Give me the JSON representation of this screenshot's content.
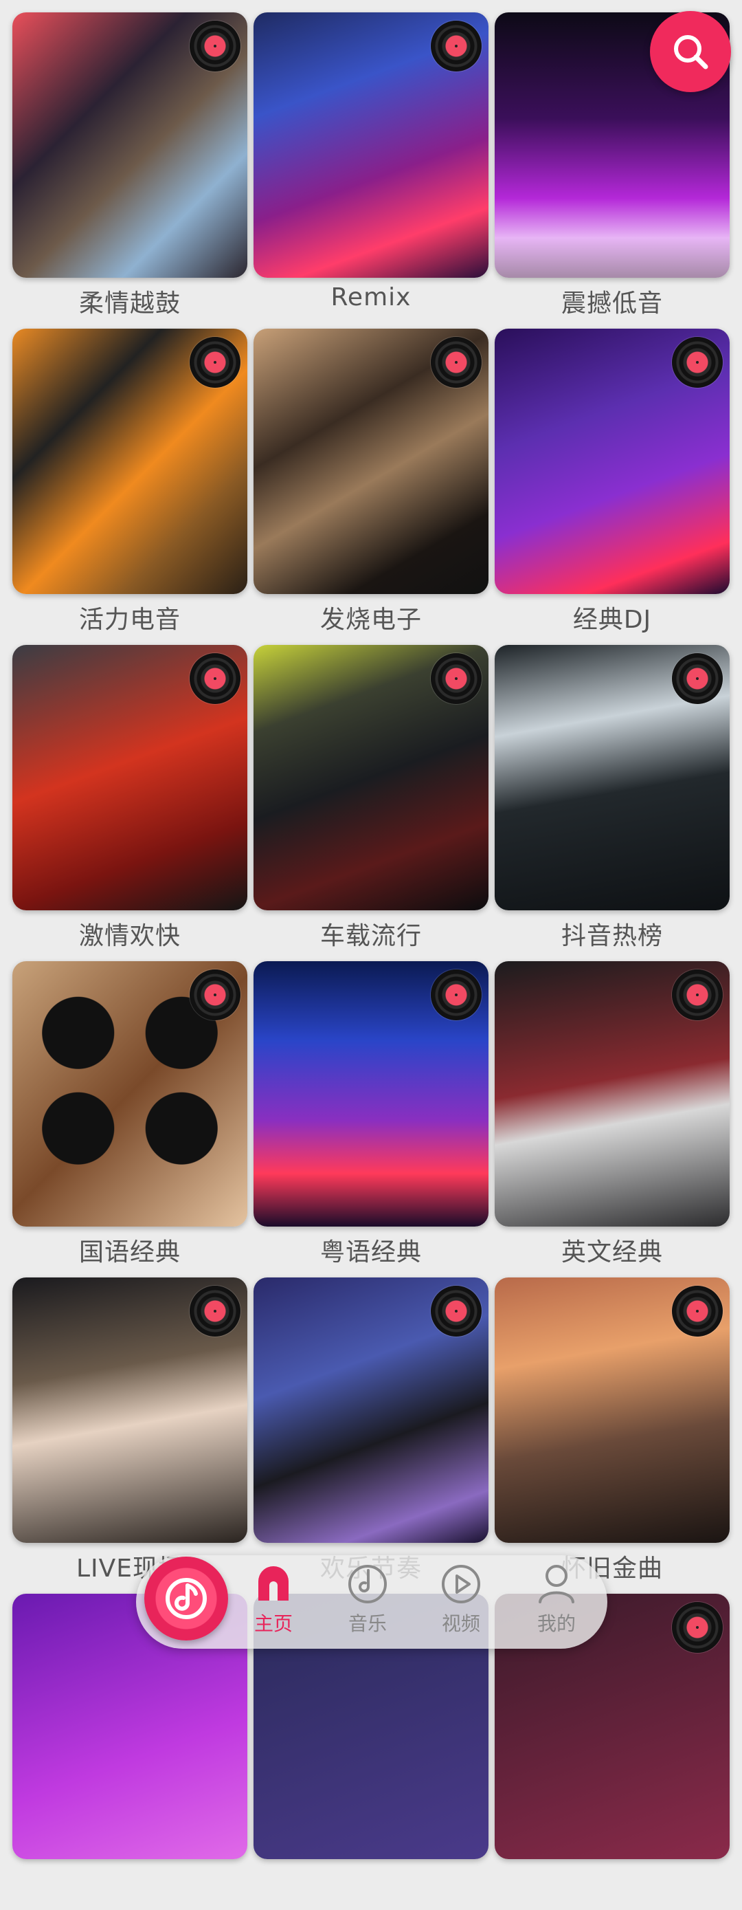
{
  "tiles": [
    {
      "label": "柔情越鼓",
      "art": "hand-drums-photo"
    },
    {
      "label": "Remix",
      "art": "mixing-console-photo"
    },
    {
      "label": "震撼低音",
      "art": "speaker-photo"
    },
    {
      "label": "活力电音",
      "art": "guitar-strings-photo"
    },
    {
      "label": "发烧电子",
      "art": "drum-kit-photo"
    },
    {
      "label": "经典DJ",
      "art": "dj-controller-photo"
    },
    {
      "label": "激情欢快",
      "art": "red-car-photo"
    },
    {
      "label": "车载流行",
      "art": "car-stereo-photo"
    },
    {
      "label": "抖音热榜",
      "art": "race-car-photo"
    },
    {
      "label": "国语经典",
      "art": "vinyl-records-photo"
    },
    {
      "label": "粤语经典",
      "art": "city-night-photo"
    },
    {
      "label": "英文经典",
      "art": "drum-set-photo"
    },
    {
      "label": "LIVE现场",
      "art": "concert-crowd-photo"
    },
    {
      "label": "欢乐节奏",
      "art": "headphones-photo"
    },
    {
      "label": "怀旧金曲",
      "art": "guitars-studio-photo"
    },
    {
      "label": "",
      "art": "purple-light-photo"
    },
    {
      "label": "",
      "art": "partial-photo"
    },
    {
      "label": "",
      "art": "partial-photo"
    }
  ],
  "search_button": {
    "icon": "search-icon"
  },
  "nav": {
    "fab_icon": "music-note-disc-icon",
    "items": [
      {
        "label": "主页",
        "icon": "home-icon",
        "active": true
      },
      {
        "label": "音乐",
        "icon": "music-icon",
        "active": false
      },
      {
        "label": "视频",
        "icon": "play-icon",
        "active": false
      },
      {
        "label": "我的",
        "icon": "user-icon",
        "active": false
      }
    ]
  },
  "colors": {
    "accent": "#e8245a",
    "background": "#ececec",
    "caption": "#555555"
  }
}
